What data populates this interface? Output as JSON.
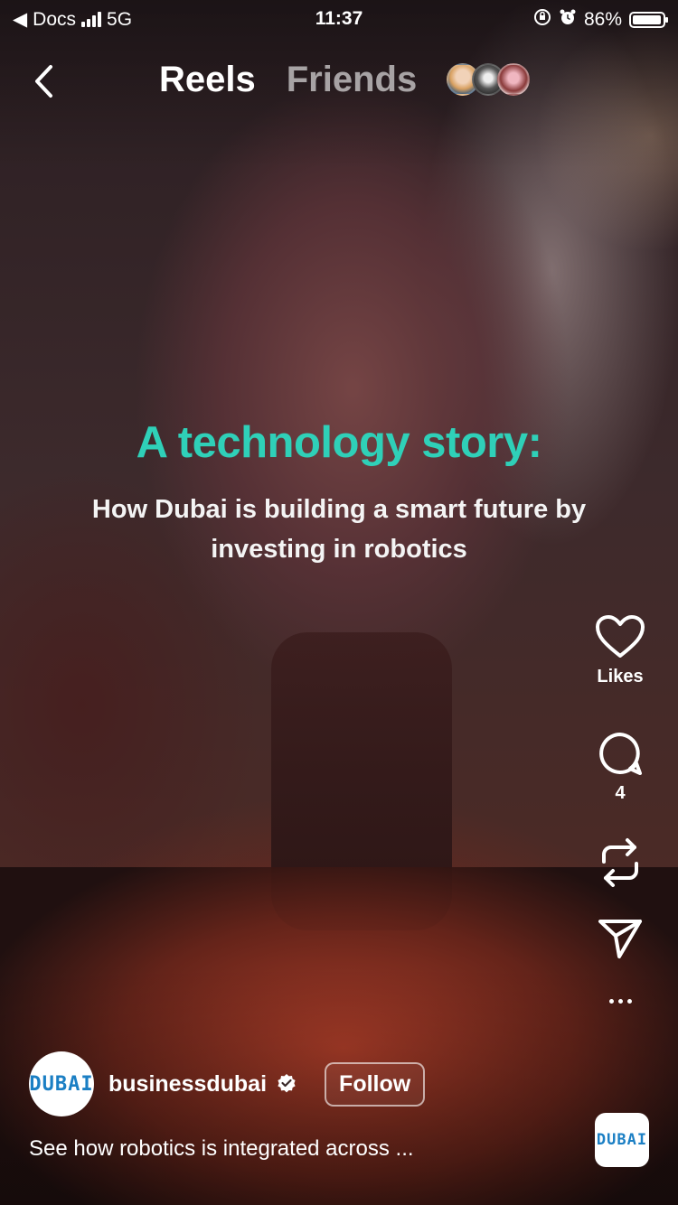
{
  "status_bar": {
    "back_app": "Docs",
    "network": "5G",
    "time": "11:37",
    "battery": "86%",
    "battery_level": 0.86
  },
  "nav": {
    "tabs": [
      "Reels",
      "Friends"
    ],
    "active_tab": "Reels"
  },
  "video": {
    "headline": "A technology story:",
    "subline": "How Dubai is building a smart future by investing in robotics",
    "headline_color": "#2fd0b8"
  },
  "actions": {
    "likes_label": "Likes",
    "comments_count": "4"
  },
  "post": {
    "username": "businessdubai",
    "follow_label": "Follow",
    "caption": "See how robotics is integrated across ...",
    "logo_text": "DUBAI"
  }
}
